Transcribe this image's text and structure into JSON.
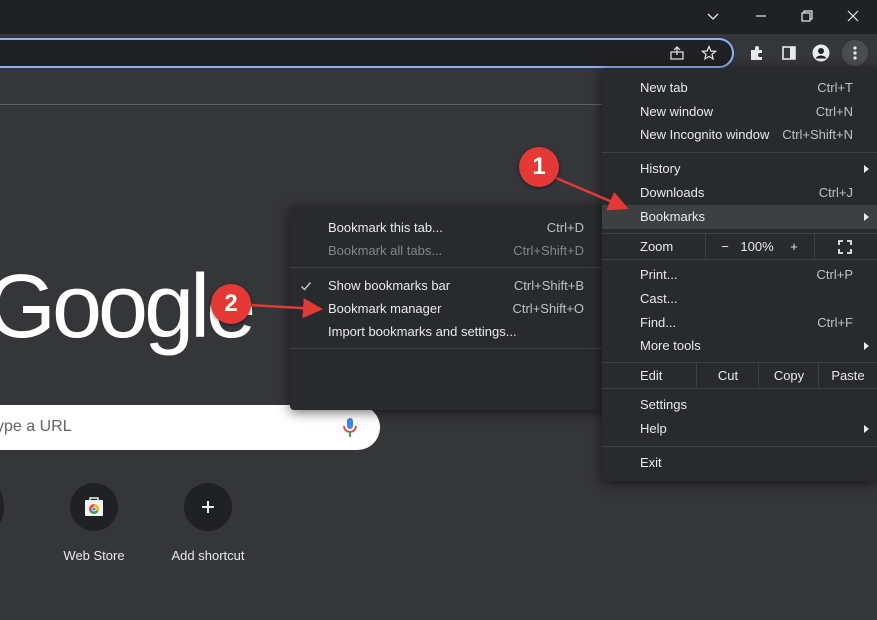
{
  "chrome": {
    "window_buttons": [
      "chevron-down-icon",
      "minimize-icon",
      "restore-icon",
      "close-icon"
    ],
    "toolbar_icons": [
      "share-icon",
      "star-icon",
      "puzzle-icon",
      "side-panel-icon",
      "profile-icon",
      "kebab-icon"
    ]
  },
  "ntp": {
    "logo": "Google",
    "search_placeholder": "ype a URL",
    "shortcuts": [
      {
        "label": "Web Store",
        "icon": "web-store-icon"
      },
      {
        "label": "Add shortcut",
        "icon": "plus-icon"
      }
    ]
  },
  "main_menu": {
    "new_tab": {
      "label": "New tab",
      "shortcut": "Ctrl+T"
    },
    "new_window": {
      "label": "New window",
      "shortcut": "Ctrl+N"
    },
    "new_incognito": {
      "label": "New Incognito window",
      "shortcut": "Ctrl+Shift+N"
    },
    "history": {
      "label": "History"
    },
    "downloads": {
      "label": "Downloads",
      "shortcut": "Ctrl+J"
    },
    "bookmarks": {
      "label": "Bookmarks"
    },
    "zoom": {
      "label": "Zoom",
      "minus": "−",
      "value": "100%",
      "plus": "+"
    },
    "print": {
      "label": "Print...",
      "shortcut": "Ctrl+P"
    },
    "cast": {
      "label": "Cast..."
    },
    "find": {
      "label": "Find...",
      "shortcut": "Ctrl+F"
    },
    "more_tools": {
      "label": "More tools"
    },
    "edit": {
      "label": "Edit",
      "cut": "Cut",
      "copy": "Copy",
      "paste": "Paste"
    },
    "settings": {
      "label": "Settings"
    },
    "help": {
      "label": "Help"
    },
    "exit": {
      "label": "Exit"
    }
  },
  "bookmarks_menu": {
    "bookmark_tab": {
      "label": "Bookmark this tab...",
      "shortcut": "Ctrl+D"
    },
    "bookmark_all": {
      "label": "Bookmark all tabs...",
      "shortcut": "Ctrl+Shift+D"
    },
    "show_bar": {
      "label": "Show bookmarks bar",
      "shortcut": "Ctrl+Shift+B",
      "checked": true
    },
    "manager": {
      "label": "Bookmark manager",
      "shortcut": "Ctrl+Shift+O"
    },
    "import": {
      "label": "Import bookmarks and settings..."
    }
  },
  "annotations": {
    "badge1": "1",
    "badge2": "2",
    "accent": "#e53935"
  }
}
